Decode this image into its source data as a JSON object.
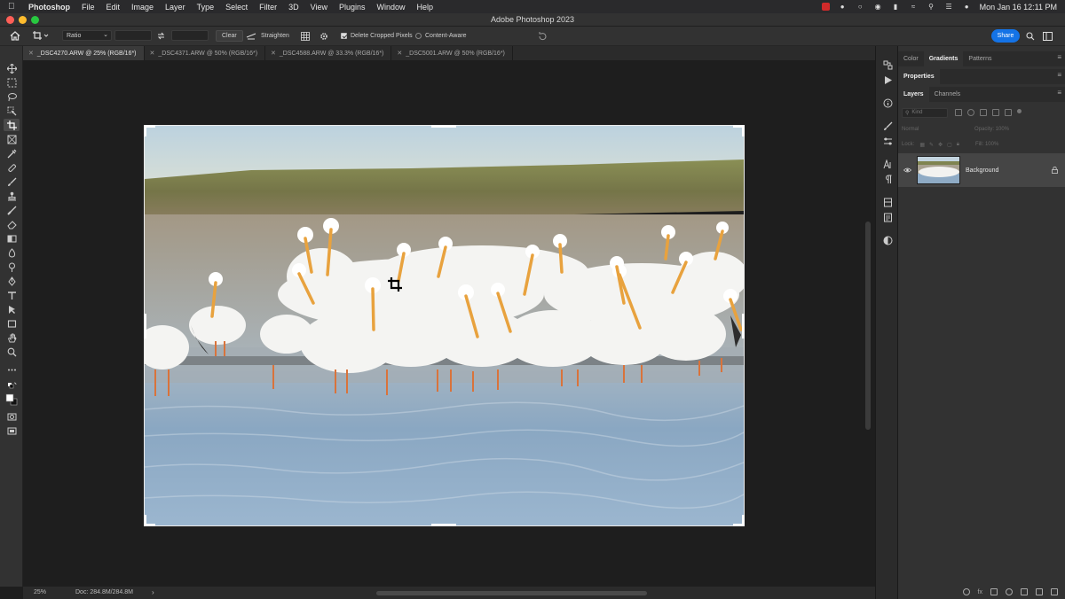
{
  "menubar": {
    "app_name": "Photoshop",
    "items": [
      "File",
      "Edit",
      "Image",
      "Layer",
      "Type",
      "Select",
      "Filter",
      "3D",
      "View",
      "Plugins",
      "Window",
      "Help"
    ],
    "clock": "Mon Jan 16  12:11 PM"
  },
  "window": {
    "title": "Adobe Photoshop 2023"
  },
  "options_bar": {
    "ratio_label": "Ratio",
    "clear_label": "Clear",
    "straighten_label": "Straighten",
    "delete_cropped_label": "Delete Cropped Pixels",
    "content_aware_label": "Content-Aware",
    "share_label": "Share"
  },
  "tabs": [
    {
      "label": "_DSC4270.ARW @ 25% (RGB/16*)",
      "active": true
    },
    {
      "label": "_DSC4371.ARW @ 50% (RGB/16*)",
      "active": false
    },
    {
      "label": "_DSC4588.ARW @ 33.3% (RGB/16*)",
      "active": false
    },
    {
      "label": "_DSC5001.ARW @ 50% (RGB/16*)",
      "active": false
    }
  ],
  "status": {
    "zoom": "25%",
    "doc": "Doc: 284.8M/284.8M"
  },
  "panels": {
    "top_tabs": [
      "Color",
      "Gradients",
      "Patterns"
    ],
    "properties": "Properties",
    "layer_tabs": [
      "Layers",
      "Channels"
    ],
    "kind": "Kind",
    "blend_mode": "Normal",
    "opacity": "Opacity: 100%",
    "lock": "Lock:",
    "fill": "Fill: 100%",
    "layer_name": "Background"
  },
  "colors": {
    "accent": "#1473e6",
    "panel": "#323232",
    "canvas_bg": "#1e1e1e"
  }
}
